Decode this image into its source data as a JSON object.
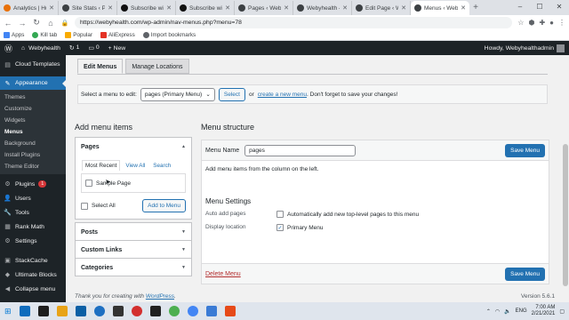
{
  "browser": {
    "tabs": [
      {
        "label": "Analytics | Hu",
        "color": "#e8710a"
      },
      {
        "label": "Site Stats ‹ Pe",
        "color": "#3c4043"
      },
      {
        "label": "Subscribe wi",
        "color": "#111"
      },
      {
        "label": "Subscribe wi",
        "color": "#111"
      },
      {
        "label": "Pages ‹ Web",
        "color": "#3c4043"
      },
      {
        "label": "Webyhealth –",
        "color": "#3c4043"
      },
      {
        "label": "Edit Page ‹ Wey",
        "color": "#3c4043"
      },
      {
        "label": "Menus ‹ Web",
        "color": "#3c4043"
      }
    ],
    "url": "https://webyhealth.com/wp-admin/nav-menus.php?menu=78",
    "bookmarks": [
      "Apps",
      "Kill tab",
      "Popular",
      "AliExpress",
      "Import bookmarks"
    ]
  },
  "adminbar": {
    "site": "Webyhealth",
    "updates": "1",
    "comments": "0",
    "new": "New",
    "howdy": "Howdy, Webyhealthadmin"
  },
  "sidebar": {
    "dashboard_partial": "Cloud Templates",
    "appearance": "Appearance",
    "sub": [
      "Themes",
      "Customize",
      "Widgets",
      "Menus",
      "Background",
      "Install Plugins",
      "Theme Editor"
    ],
    "items": [
      {
        "label": "Plugins",
        "icon": "plugin-icon",
        "badge": "1"
      },
      {
        "label": "Users",
        "icon": "users-icon"
      },
      {
        "label": "Tools",
        "icon": "tools-icon"
      },
      {
        "label": "Rank Math",
        "icon": "rank-math-icon"
      },
      {
        "label": "Settings",
        "icon": "settings-icon"
      },
      {
        "label": "StackCache",
        "icon": "stackcache-icon"
      },
      {
        "label": "Ultimate Blocks",
        "icon": "ultimate-blocks-icon"
      },
      {
        "label": "Collapse menu",
        "icon": "collapse-icon"
      }
    ]
  },
  "main": {
    "tabs": [
      "Edit Menus",
      "Manage Locations"
    ],
    "select_label": "Select a menu to edit:",
    "select_value": "pages (Primary Menu)",
    "select_button": "Select",
    "or": "or",
    "create_link": "create a new menu",
    "dont_forget": ". Don't forget to save your changes!",
    "add_items_title": "Add menu items",
    "structure_title": "Menu structure",
    "pages_panel": {
      "title": "Pages",
      "tabs": [
        "Most Recent",
        "View All",
        "Search"
      ],
      "item": "Sample Page",
      "select_all": "Select All",
      "add_button": "Add to Menu"
    },
    "collapsed_panels": [
      "Posts",
      "Custom Links",
      "Categories"
    ],
    "menu_name_label": "Menu Name",
    "menu_name_value": "pages",
    "save_label": "Save Menu",
    "instructions": "Add menu items from the column on the left.",
    "settings_title": "Menu Settings",
    "auto_add_label": "Auto add pages",
    "auto_add_text": "Automatically add new top-level pages to this menu",
    "display_label": "Display location",
    "display_value": "Primary Menu",
    "delete_link": "Delete Menu",
    "footer_text_pre": "Thank you for creating with ",
    "footer_link": "WordPress",
    "footer_text_post": ".",
    "version": "Version 5.6.1"
  },
  "taskbar": {
    "lang": "ENG",
    "time": "7:00 AM",
    "date": "2/21/2021"
  }
}
